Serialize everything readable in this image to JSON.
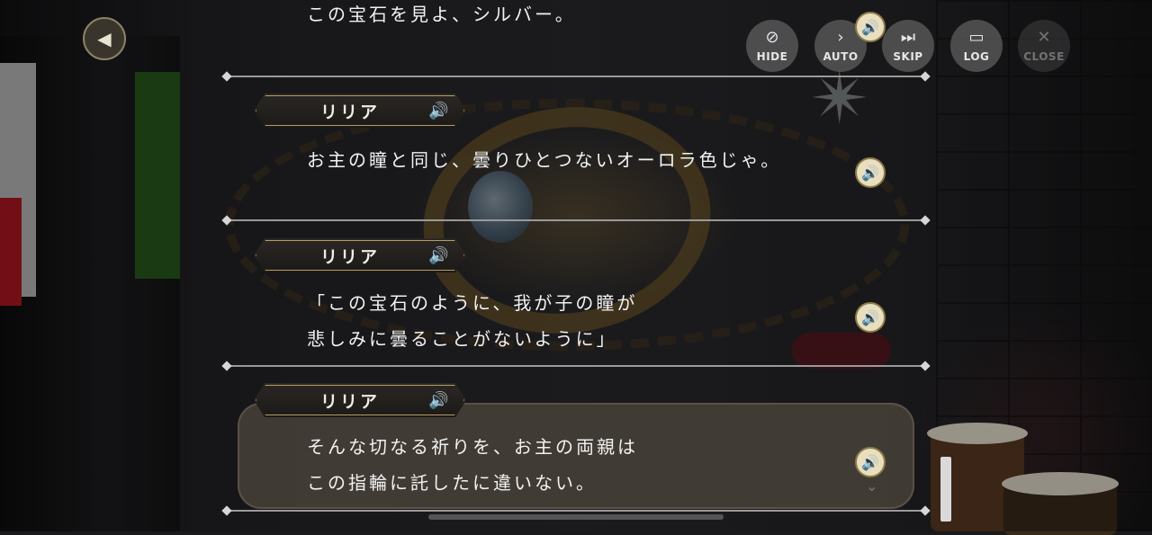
{
  "controls": {
    "hide": "HIDE",
    "auto": "AUTO",
    "skip": "SKIP",
    "log": "LOG",
    "close": "CLOSE"
  },
  "icons": {
    "back": "chevron-left-icon",
    "voice": "speaker-icon"
  },
  "log": {
    "top_partial_text": "この宝石を見よ、シルバー。",
    "entries": [
      {
        "speaker": "リリア",
        "lines": [
          "お主の瞳と同じ、曇りひとつないオーロラ色じゃ。"
        ]
      },
      {
        "speaker": "リリア",
        "lines": [
          "「この宝石のように、我が子の瞳が",
          "悲しみに曇ることがないように」"
        ]
      },
      {
        "speaker": "リリア",
        "lines": [
          "そんな切なる祈りを、お主の両親は",
          "この指輪に託したに違いない。"
        ],
        "current": true
      }
    ]
  },
  "colors": {
    "accent_gold": "#b59c62",
    "voice_button": "#e9dfbf",
    "current_box": "#46403a"
  }
}
